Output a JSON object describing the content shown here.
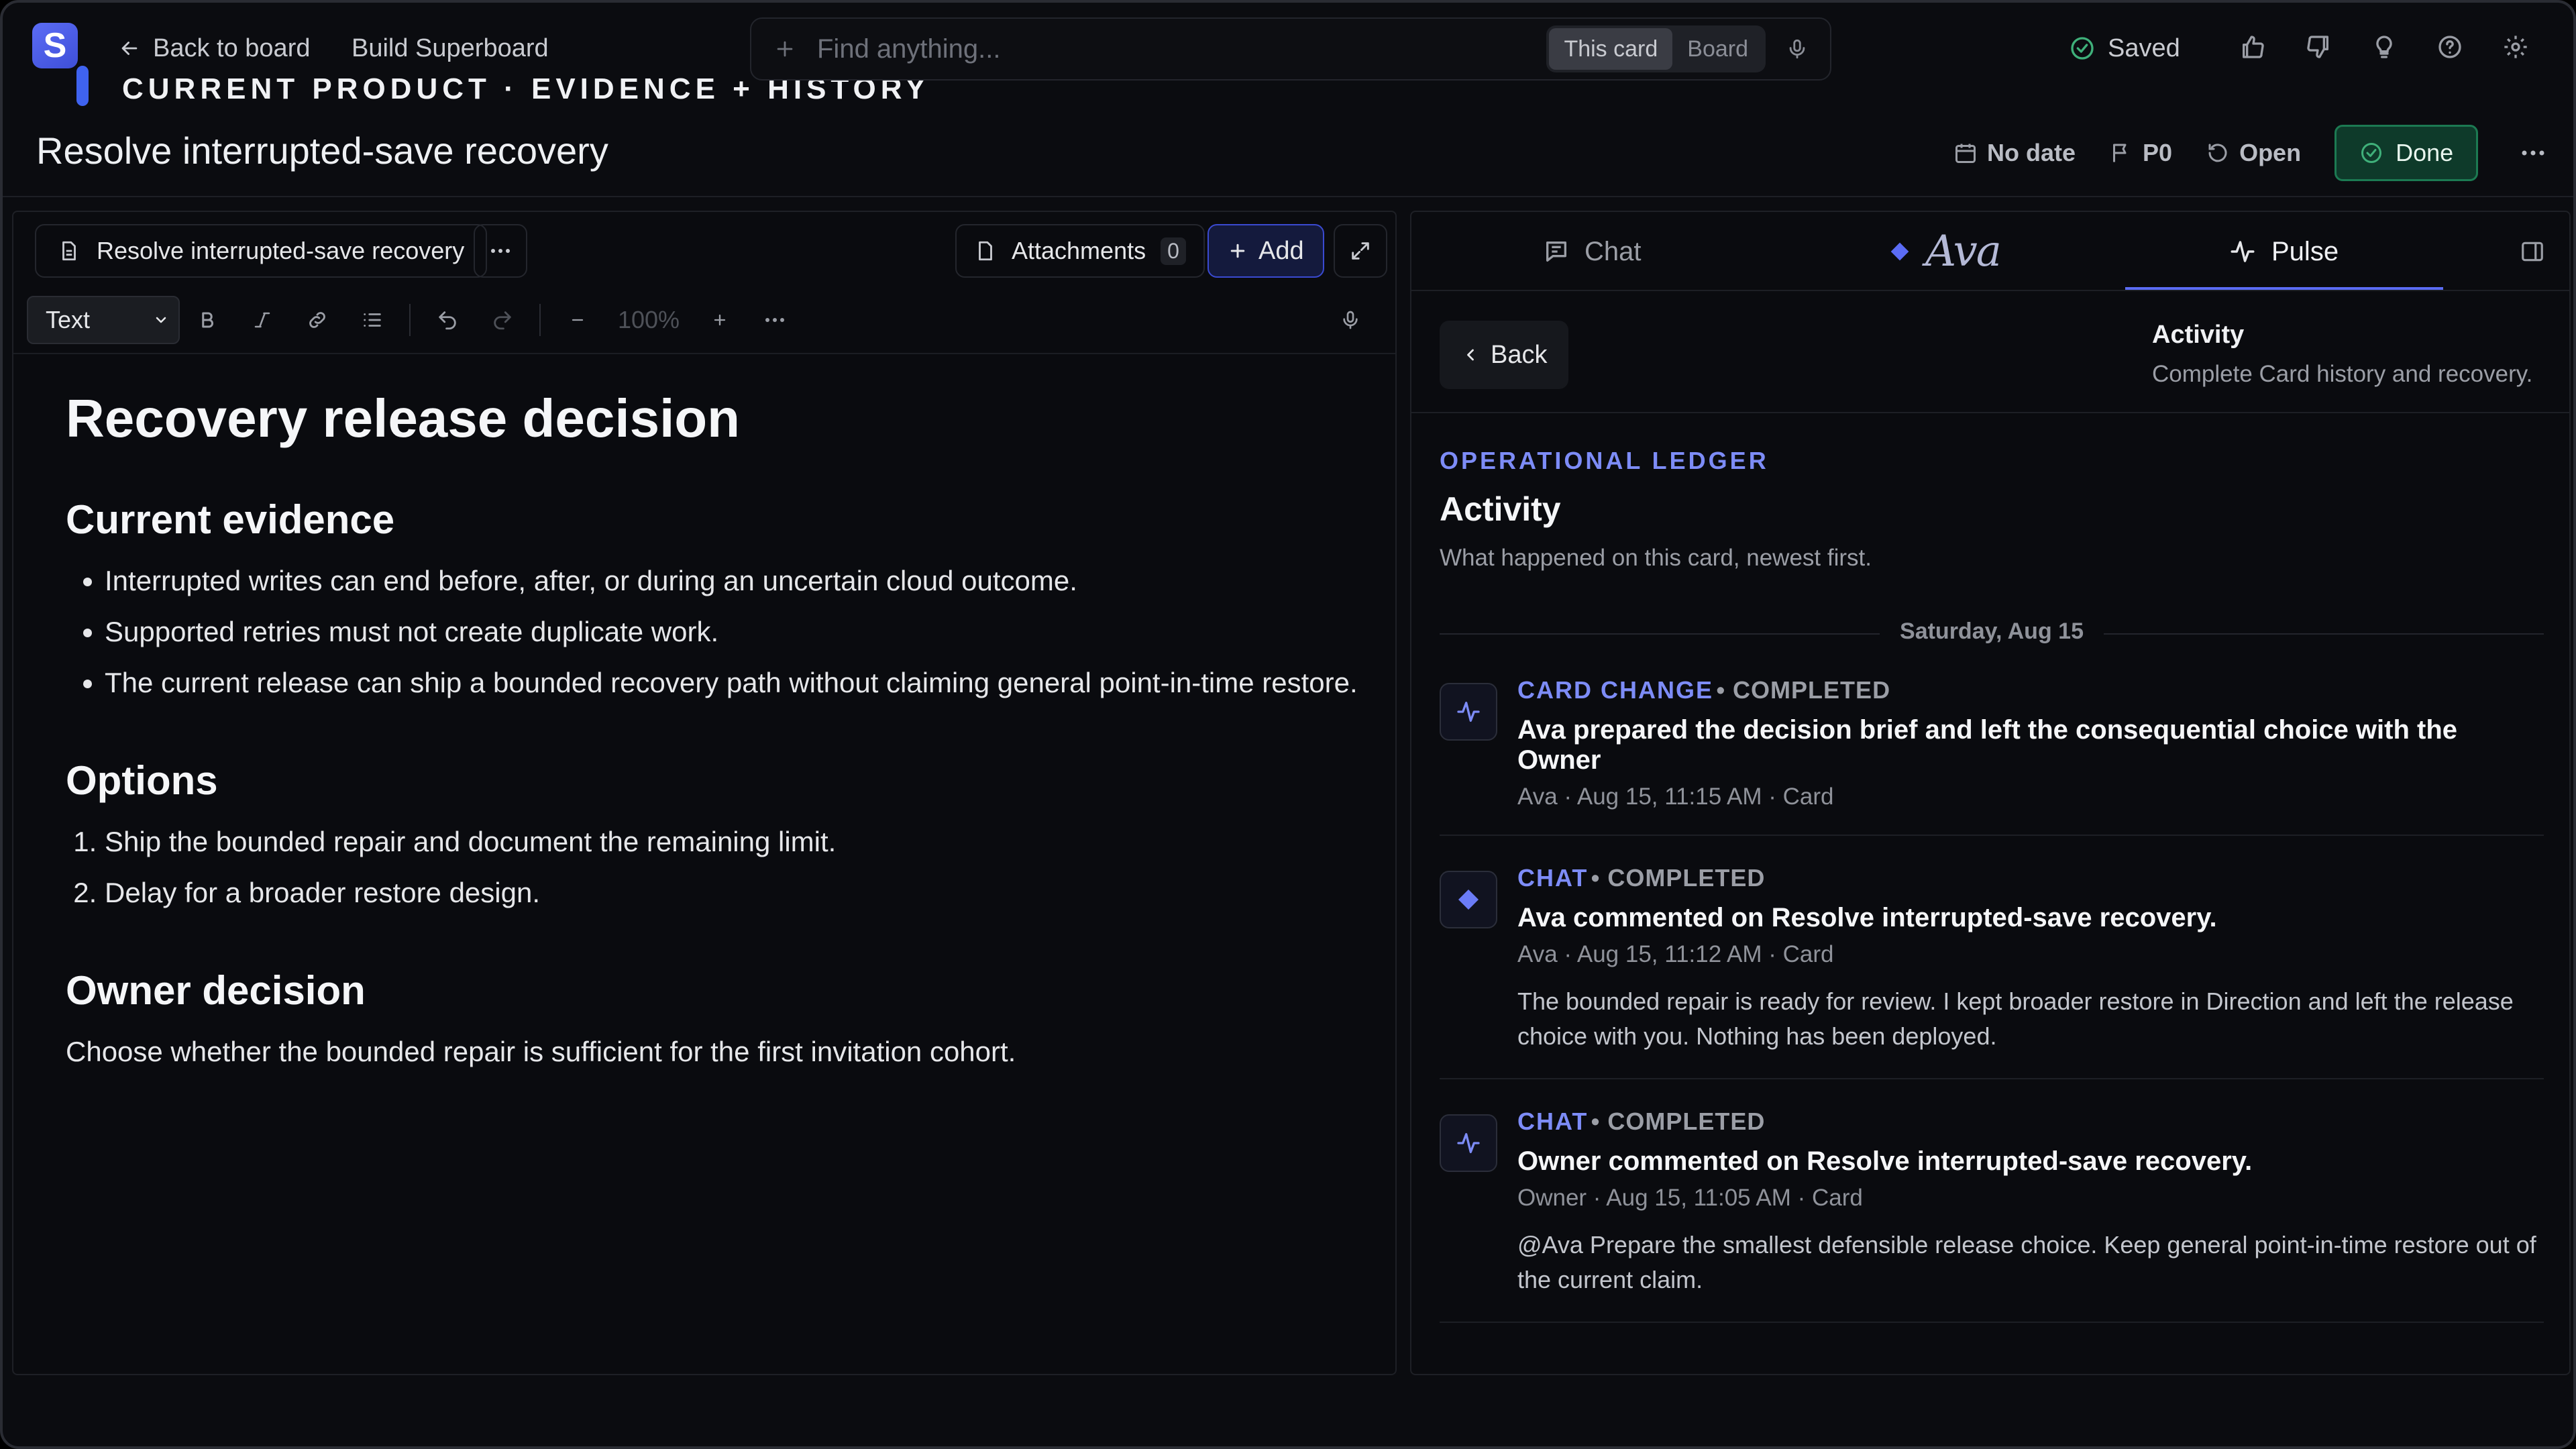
{
  "colors": {
    "accent": "#5b6cf5",
    "success": "#1c7a52",
    "background": "#0b0c10"
  },
  "topbar": {
    "logo_letter": "S",
    "back_label": "Back to board",
    "breadcrumb": "Build Superboard",
    "kicker": "CURRENT PRODUCT · EVIDENCE + HISTORY",
    "search_placeholder": "Find anything...",
    "scope_options": [
      "This card",
      "Board"
    ],
    "scope_selected": "This card",
    "saved_label": "Saved"
  },
  "card": {
    "title": "Resolve interrupted-save recovery",
    "date_label": "No date",
    "priority_label": "P0",
    "status_label": "Open",
    "done_label": "Done"
  },
  "editor": {
    "doc_tab": "Resolve interrupted-save recovery",
    "attachments_label": "Attachments",
    "attachments_count": "0",
    "add_label": "Add",
    "format_value": "Text",
    "zoom": "100%"
  },
  "document": {
    "title": "Recovery release decision",
    "sections": {
      "evidence": {
        "heading": "Current evidence",
        "items": [
          "Interrupted writes can end before, after, or during an uncertain cloud outcome.",
          "Supported retries must not create duplicate work.",
          "The current release can ship a bounded recovery path without claiming general point-in-time restore."
        ]
      },
      "options": {
        "heading": "Options",
        "items": [
          "Ship the bounded repair and document the remaining limit.",
          "Delay for a broader restore design."
        ]
      },
      "decision": {
        "heading": "Owner decision",
        "text": "Choose whether the bounded repair is sufficient for the first invitation cohort."
      }
    }
  },
  "side": {
    "tabs": {
      "chat": "Chat",
      "ava": "Ava",
      "pulse": "Pulse"
    },
    "back_label": "Back",
    "activity_title": "Activity",
    "activity_desc": "Complete Card history and recovery.",
    "eyebrow": "OPERATIONAL LEDGER",
    "heading": "Activity",
    "intro": "What happened on this card, newest first.",
    "day": "Saturday, Aug 15",
    "entries": [
      {
        "type": "CARD CHANGE",
        "status": "• COMPLETED",
        "icon": "pulse-icon",
        "headline": "Ava prepared the decision brief and left the consequential choice with the Owner",
        "meta": "Ava · Aug 15, 11:15 AM · Card",
        "body": ""
      },
      {
        "type": "CHAT",
        "status": "• COMPLETED",
        "icon": "diamond-icon",
        "headline": "Ava commented on Resolve interrupted-save recovery.",
        "meta": "Ava · Aug 15, 11:12 AM · Card",
        "body": "The bounded repair is ready for review. I kept broader restore in Direction and left the release choice with you. Nothing has been deployed."
      },
      {
        "type": "CHAT",
        "status": "• COMPLETED",
        "icon": "pulse-icon",
        "headline": "Owner commented on Resolve interrupted-save recovery.",
        "meta": "Owner · Aug 15, 11:05 AM · Card",
        "body": "@Ava Prepare the smallest defensible release choice. Keep general point-in-time restore out of the current claim."
      }
    ]
  }
}
